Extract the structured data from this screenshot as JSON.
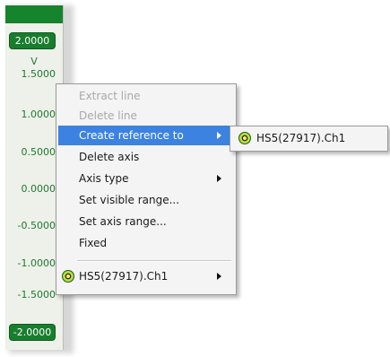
{
  "colors": {
    "accent_green": "#16842c",
    "axis_text_green": "#1d7a2f",
    "menu_highlight_blue": "#3c82e0"
  },
  "axis": {
    "max_label": "2.0000",
    "unit": "V",
    "ticks": [
      "1.5000",
      "1.0000",
      "0.5000",
      "0.0000",
      "-0.5000",
      "-1.0000",
      "-1.5000"
    ],
    "min_label": "-2.0000"
  },
  "context_menu": {
    "items": [
      {
        "label": "Extract line",
        "enabled": false
      },
      {
        "label": "Delete line",
        "enabled": false
      },
      {
        "label": "Create reference to",
        "enabled": true,
        "highlighted": true,
        "submenu": true
      },
      {
        "label": "Delete axis",
        "enabled": true
      },
      {
        "label": "Axis type",
        "enabled": true,
        "submenu": true
      },
      {
        "label": "Set visible range...",
        "enabled": true
      },
      {
        "label": "Set axis range...",
        "enabled": true
      },
      {
        "label": "Fixed",
        "enabled": true
      },
      {
        "label": "HS5(27917).Ch1",
        "enabled": true,
        "icon": "channel-icon",
        "submenu": true
      }
    ]
  },
  "reference_submenu": {
    "items": [
      {
        "label": "HS5(27917).Ch1",
        "icon": "channel-icon"
      }
    ]
  }
}
